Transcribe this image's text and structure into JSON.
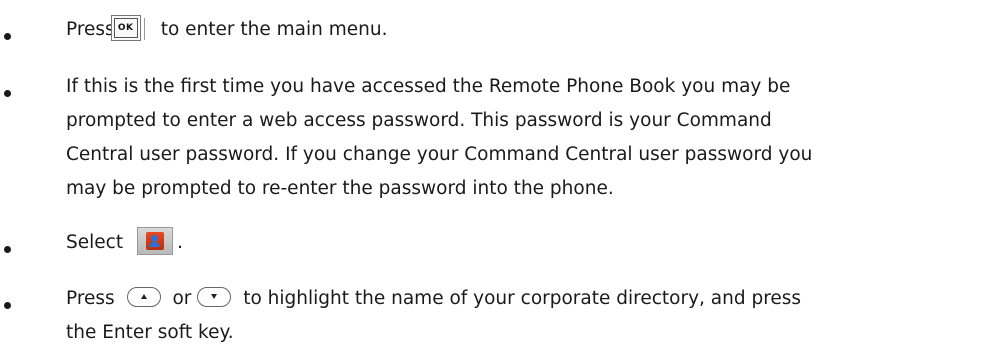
{
  "steps": [
    {
      "before": "Press",
      "icon": "ok-key-icon",
      "icon_label": "OK",
      "after": "to enter the main menu."
    },
    {
      "lines": [
        "If this is the first time you have accessed the Remote Phone Book you may be",
        "prompted to enter a web access password. This password is your Command",
        "Central user password. If you change your Command Central user password you",
        "may be prompted to re-enter the password into the phone."
      ]
    },
    {
      "before": "Select",
      "icon": "phone-book-icon",
      "after": "."
    },
    {
      "before": "Press",
      "icon_up": "up-arrow-key-icon",
      "middle": "or",
      "icon_down": "down-arrow-key-icon",
      "after": "to highlight the name of your corporate directory, and press",
      "continuation": "the Enter soft key."
    }
  ],
  "colors": {
    "text": "#1a1a1a",
    "book_cover": "#d9431a",
    "book_person": "#2f6fd1"
  }
}
